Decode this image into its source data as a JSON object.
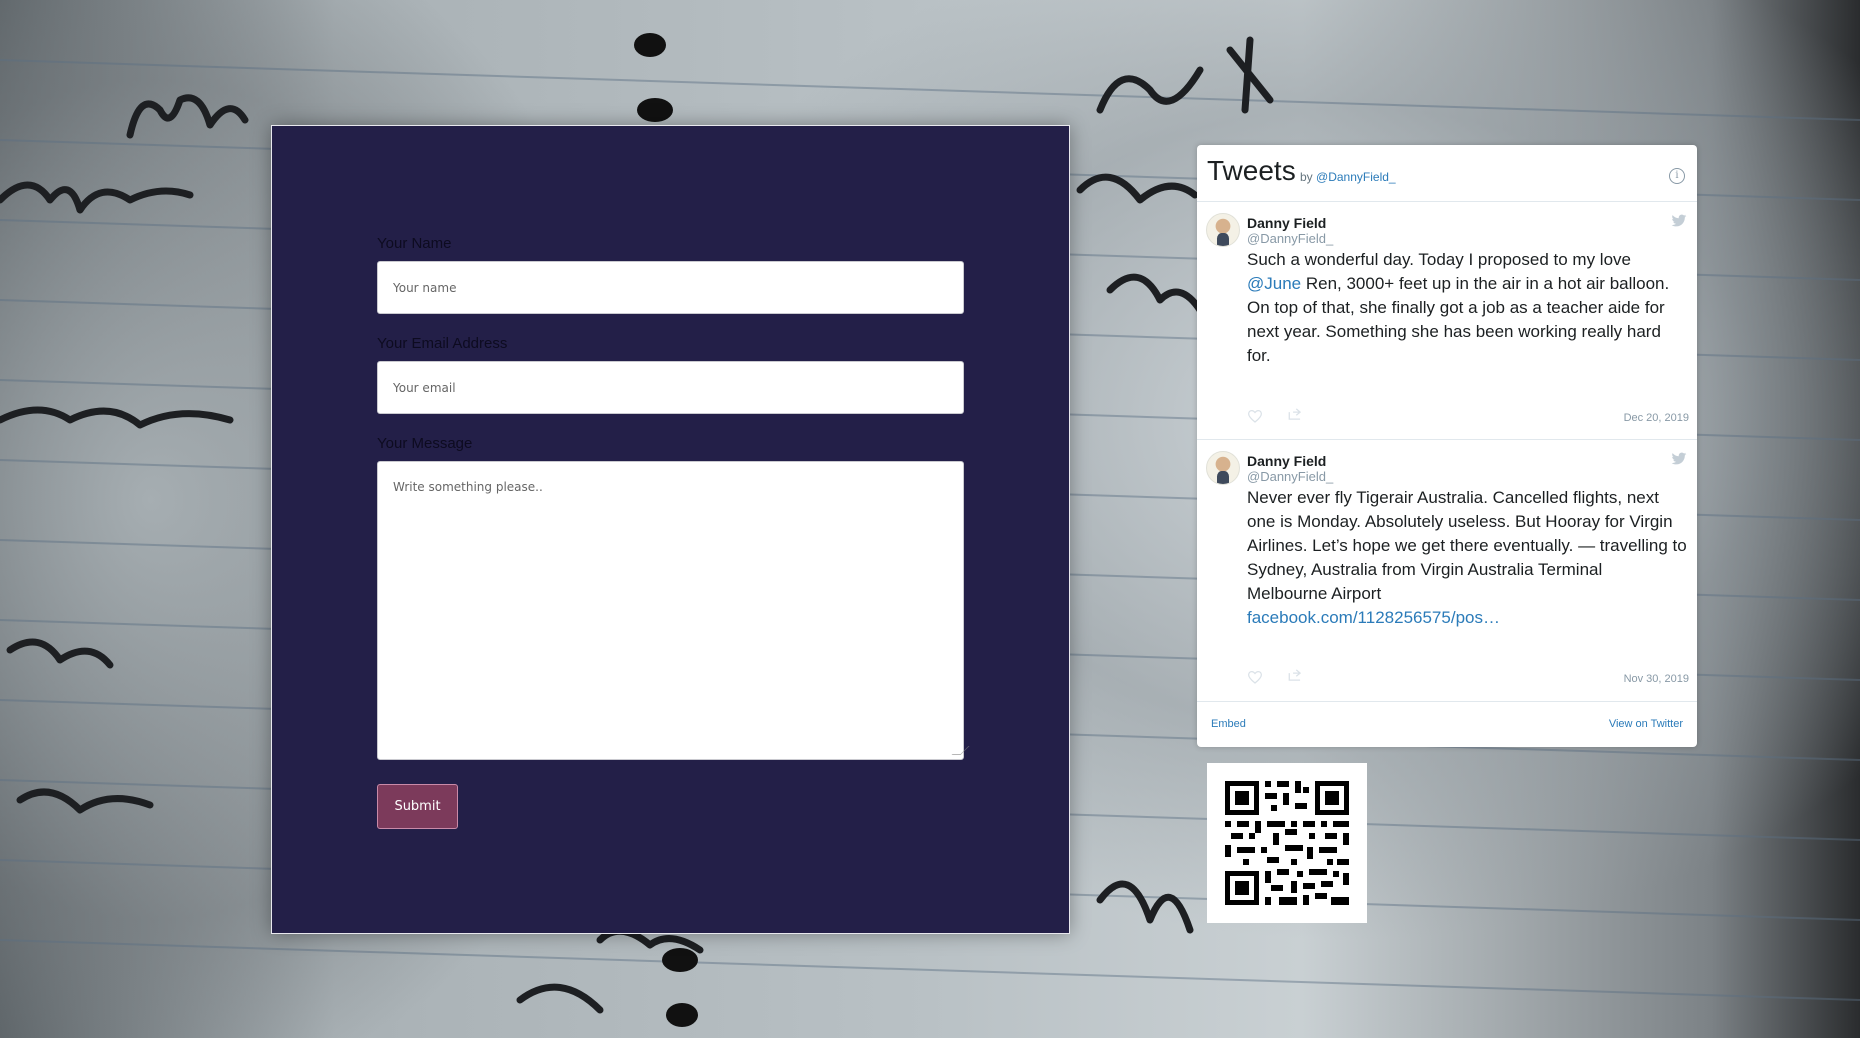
{
  "contact_form": {
    "name_label": "Your Name",
    "name_placeholder": "Your name",
    "email_label": "Your Email Address",
    "email_placeholder": "Your email",
    "message_label": "Your Message",
    "message_placeholder": "Write something please..",
    "submit_label": "Submit"
  },
  "twitter_widget": {
    "title": "Tweets",
    "by_prefix": "by",
    "by_handle": "@DannyField_",
    "info_icon": "info-icon",
    "tweets": [
      {
        "author": "Danny Field",
        "handle": "@DannyField_",
        "text_before": "Such a wonderful day. Today I proposed to my love ",
        "mention": "@June",
        "text_after": " Ren, 3000+ feet up in the air in a hot air balloon. On top of that, she finally got a job as a teacher aide for next year. Something she has been working really hard for.",
        "date": "Dec 20, 2019"
      },
      {
        "author": "Danny Field",
        "handle": "@DannyField_",
        "text": "Never ever fly Tigerair Australia. Cancelled flights, next one is Monday. Absolutely useless. But Hooray for Virgin Airlines. Let’s hope we get there eventually. — travelling to Sydney, Australia from Virgin Australia Terminal Melbourne Airport",
        "link": "facebook.com/1128256575/pos…",
        "date": "Nov 30, 2019"
      }
    ],
    "footer_embed": "Embed",
    "footer_view": "View on Twitter"
  },
  "colors": {
    "form_background": "#231f48",
    "submit_background": "#7c3a5b",
    "link_blue": "#2b7bb9"
  },
  "icons": [
    "info-icon",
    "twitter-bird-icon",
    "heart-icon",
    "share-icon",
    "qr-code"
  ]
}
